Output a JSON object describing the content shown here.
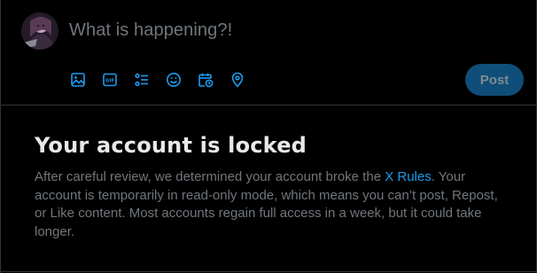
{
  "composer": {
    "placeholder": "What is happening?!",
    "post_label": "Post",
    "toolbar_icons": [
      "image-icon",
      "gif-icon",
      "poll-icon",
      "emoji-icon",
      "schedule-icon",
      "location-icon"
    ]
  },
  "notice": {
    "title": "Your account is locked",
    "body_before_link": "After careful review, we determined your account broke the ",
    "link_text": "X Rules",
    "body_after_link": ". Your account is temporarily in read-only mode, which means you can’t post, Repost, or Like content. Most accounts regain full access in a week, but it could take longer."
  },
  "colors": {
    "background": "#000000",
    "accent": "#1d9bf0",
    "post_button_disabled": "#0f4e78",
    "muted_text": "#71767b",
    "primary_text": "#e7e9ea",
    "divider": "#2f3336"
  }
}
